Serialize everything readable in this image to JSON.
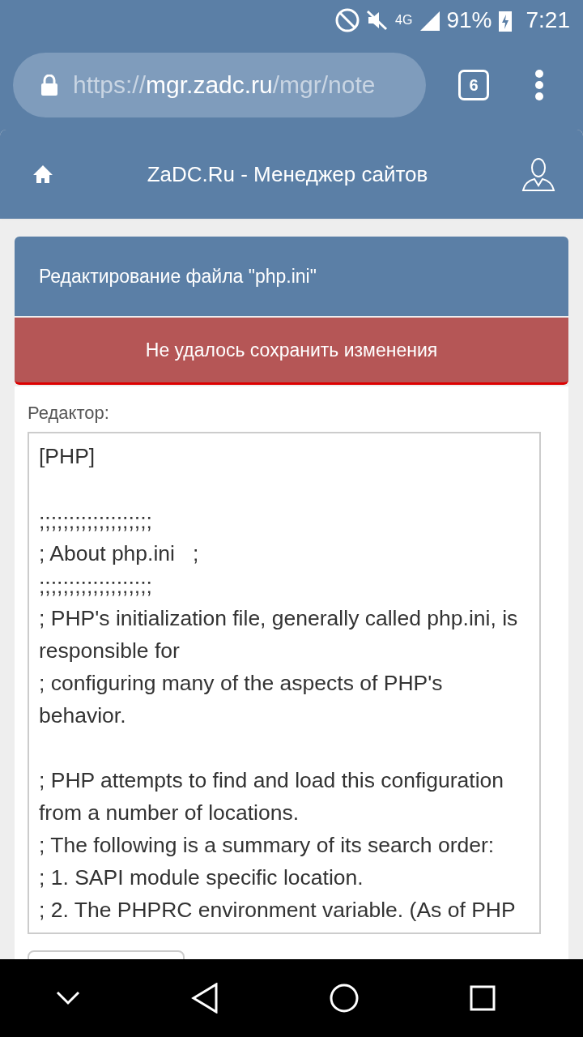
{
  "status_bar": {
    "network": "4G",
    "battery": "91%",
    "time": "7:21"
  },
  "browser": {
    "url_scheme": "https://",
    "url_host": "mgr.zadc.ru",
    "url_path": "/mgr/note",
    "tab_count": "6"
  },
  "header": {
    "title": "ZaDC.Ru - Менеджер сайтов"
  },
  "panel_title": "Редактирование файла \"php.ini\"",
  "error_message": "Не удалось сохранить изменения",
  "editor": {
    "label": "Редактор:",
    "lines": [
      {
        "text": "[PHP]",
        "gap_before": false
      },
      {
        "text": ";;;;;;;;;;;;;;;;;;;",
        "gap_before": true
      },
      {
        "text": "; About php.ini   ;",
        "gap_before": false
      },
      {
        "text": ";;;;;;;;;;;;;;;;;;;",
        "gap_before": false
      },
      {
        "text": "; PHP's initialization file, generally called php.ini, is responsible for",
        "gap_before": false
      },
      {
        "text": "; configuring many of the aspects of PHP's behavior.",
        "gap_before": false
      },
      {
        "text": "; PHP attempts to find and load this configuration from a number of locations.",
        "gap_before": true
      },
      {
        "text": "; The following is a summary of its search order:",
        "gap_before": false
      },
      {
        "text": "; 1. SAPI module specific location.",
        "gap_before": false
      },
      {
        "text": "; 2. The PHPRC environment variable. (As of PHP",
        "gap_before": false
      }
    ]
  }
}
